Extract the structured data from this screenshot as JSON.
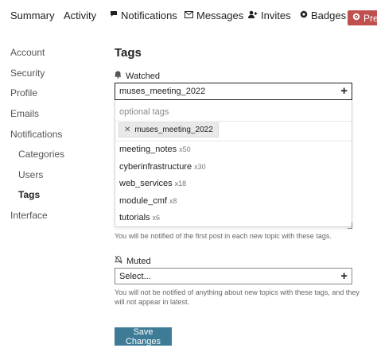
{
  "topnav": {
    "tabs": [
      {
        "label": "Summary",
        "icon": ""
      },
      {
        "label": "Activity",
        "icon": ""
      },
      {
        "label": "Notifications",
        "icon": "speech-bubble-icon"
      },
      {
        "label": "Messages",
        "icon": "envelope-icon"
      },
      {
        "label": "Invites",
        "icon": "user-plus-icon"
      },
      {
        "label": "Badges",
        "icon": "certificate-icon"
      }
    ],
    "preferences_label": "Pre",
    "preferences_color": "#c0504d"
  },
  "sidebar": {
    "items": [
      {
        "label": "Account"
      },
      {
        "label": "Security"
      },
      {
        "label": "Profile"
      },
      {
        "label": "Emails"
      },
      {
        "label": "Notifications"
      },
      {
        "label": "Categories"
      },
      {
        "label": "Users"
      },
      {
        "label": "Tags",
        "active": true
      },
      {
        "label": "Interface"
      }
    ]
  },
  "main": {
    "title": "Tags",
    "watched": {
      "label": "Watched",
      "icon": "bell-icon",
      "value": "muses_meeting_2022",
      "dropdown": {
        "filter_placeholder": "optional tags",
        "selected_chip": "muses_meeting_2022",
        "options": [
          {
            "name": "meeting_notes",
            "count": "x50"
          },
          {
            "name": "cyberinfrastructure",
            "count": "x30"
          },
          {
            "name": "web_services",
            "count": "x18"
          },
          {
            "name": "module_cmf",
            "count": "x8"
          },
          {
            "name": "tutorials",
            "count": "x6"
          }
        ]
      },
      "hint": "You will be notified of the first post in each new topic with these tags."
    },
    "muted": {
      "label": "Muted",
      "icon": "bell-slash-icon",
      "placeholder": "Select...",
      "hint_line1": "You will not be notified of anything about new topics with these tags, and they",
      "hint_line2": "will not appear in latest."
    },
    "save_label": "Save Changes",
    "save_color": "#3d7b96"
  }
}
